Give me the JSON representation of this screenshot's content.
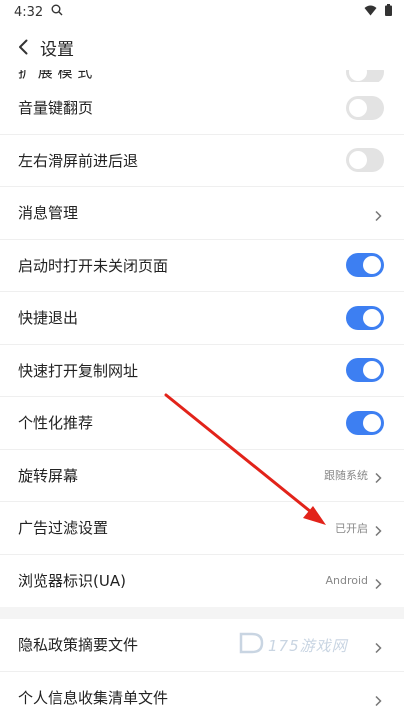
{
  "status_bar": {
    "time": "4:32"
  },
  "header": {
    "title": "设置"
  },
  "partial_top": {
    "label": "扩 展 模 式"
  },
  "rows": [
    {
      "label": "音量键翻页",
      "control": "toggle",
      "state": "off"
    },
    {
      "label": "左右滑屏前进后退",
      "control": "toggle",
      "state": "off"
    },
    {
      "label": "消息管理",
      "control": "chevron"
    },
    {
      "label": "启动时打开未关闭页面",
      "control": "toggle",
      "state": "on"
    },
    {
      "label": "快捷退出",
      "control": "toggle",
      "state": "on"
    },
    {
      "label": "快速打开复制网址",
      "control": "toggle",
      "state": "on"
    },
    {
      "label": "个性化推荐",
      "control": "toggle",
      "state": "on"
    },
    {
      "label": "旋转屏幕",
      "control": "value",
      "value": "跟随系统"
    },
    {
      "label": "广告过滤设置",
      "control": "value",
      "value": "已开启"
    },
    {
      "label": "浏览器标识(UA)",
      "control": "value",
      "value": "Android"
    }
  ],
  "rows2": [
    {
      "label": "隐私政策摘要文件",
      "control": "chevron"
    },
    {
      "label": "个人信息收集清单文件",
      "control": "chevron"
    }
  ],
  "watermark": {
    "text": "175游戏网"
  },
  "colors": {
    "accent": "#3d7ff2",
    "arrow": "#e2231a",
    "toggle_off": "#e3e3e3"
  }
}
